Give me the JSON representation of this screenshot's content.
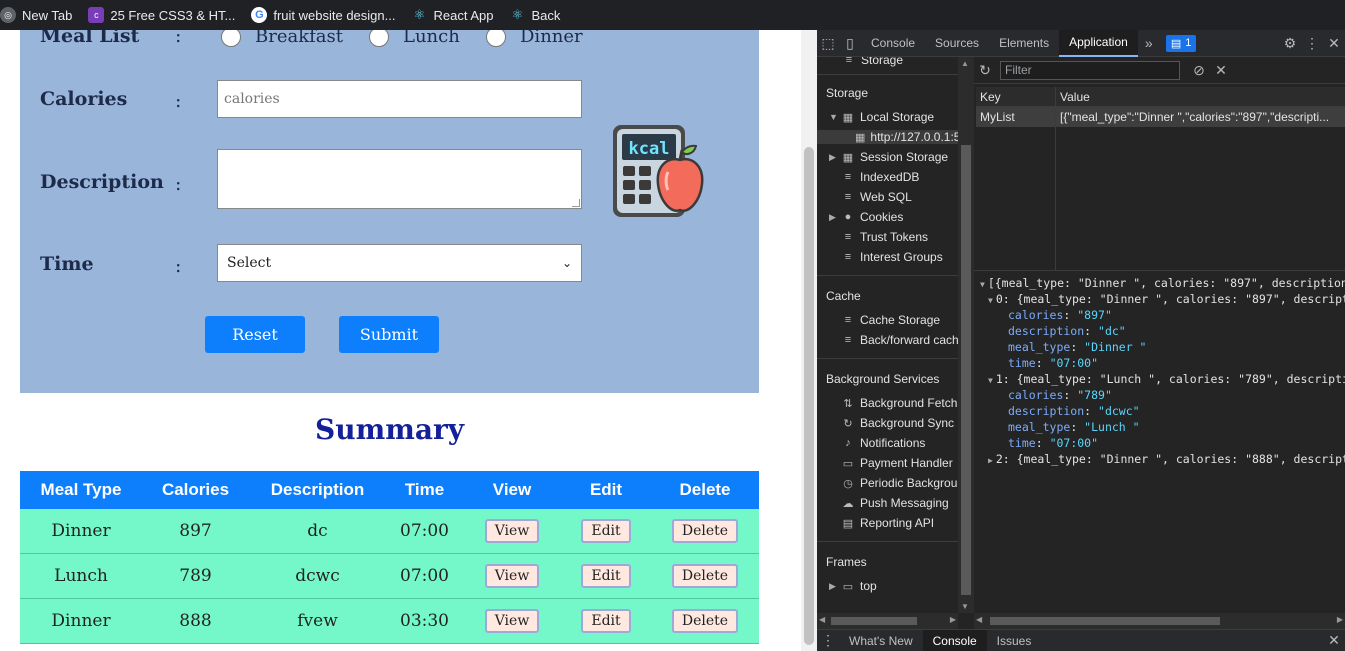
{
  "bookmarks": [
    {
      "label": "New Tab",
      "icon": "globe-icon"
    },
    {
      "label": "25 Free CSS3 & HT...",
      "icon": "colorlib-icon"
    },
    {
      "label": "fruit website design...",
      "icon": "google-icon"
    },
    {
      "label": "React App",
      "icon": "react-icon"
    },
    {
      "label": "Back",
      "icon": "react-icon"
    }
  ],
  "form": {
    "meal_label": "Meal List",
    "meal_options": [
      "Breakfast",
      "Lunch",
      "Dinner"
    ],
    "calories_label": "Calories",
    "calories_placeholder": "calories",
    "description_label": "Description",
    "time_label": "Time",
    "time_selected": "Select",
    "colon": ":",
    "reset_label": "Reset",
    "submit_label": "Submit",
    "image_text": "kcal"
  },
  "summary": {
    "title": "Summary",
    "headers": [
      "Meal Type",
      "Calories",
      "Description",
      "Time",
      "View",
      "Edit",
      "Delete"
    ],
    "rows": [
      {
        "meal_type": "Dinner",
        "calories": "897",
        "description": "dc",
        "time": "07:00",
        "view": "View",
        "edit": "Edit",
        "delete": "Delete"
      },
      {
        "meal_type": "Lunch",
        "calories": "789",
        "description": "dcwc",
        "time": "07:00",
        "view": "View",
        "edit": "Edit",
        "delete": "Delete"
      },
      {
        "meal_type": "Dinner",
        "calories": "888",
        "description": "fvew",
        "time": "03:30",
        "view": "View",
        "edit": "Edit",
        "delete": "Delete"
      }
    ]
  },
  "devtools": {
    "tabs": [
      "Console",
      "Sources",
      "Elements",
      "Application"
    ],
    "active_tab": "Application",
    "issue_count": "1",
    "sidebar": {
      "storage_header": "Storage",
      "local_storage": "Local Storage",
      "local_storage_origin": "http://127.0.0.1:5",
      "session_storage": "Session Storage",
      "indexeddb": "IndexedDB",
      "web_sql": "Web SQL",
      "cookies": "Cookies",
      "trust_tokens": "Trust Tokens",
      "interest_groups": "Interest Groups",
      "cache_header": "Cache",
      "cache_storage": "Cache Storage",
      "back_forward": "Back/forward cach",
      "bg_header": "Background Services",
      "bg_fetch": "Background Fetch",
      "bg_sync": "Background Sync",
      "notifications": "Notifications",
      "payment_handler": "Payment Handler",
      "periodic": "Periodic Backgroun",
      "push": "Push Messaging",
      "reporting": "Reporting API",
      "frames_header": "Frames",
      "top_frame": "top",
      "cut_item": "Storage"
    },
    "filter_placeholder": "Filter",
    "table": {
      "key_header": "Key",
      "value_header": "Value",
      "key": "MyList",
      "value": "[{\"meal_type\":\"Dinner \",\"calories\":\"897\",\"descripti..."
    },
    "json_lines": [
      {
        "indent": 0,
        "tri": "▼",
        "text": "[{meal_type: \"Dinner \", calories: \"897\", description:"
      },
      {
        "indent": 1,
        "tri": "▼",
        "text": "0: {meal_type: \"Dinner \", calories: \"897\", descripti"
      },
      {
        "indent": 2,
        "key": "calories",
        "val": "\"897\""
      },
      {
        "indent": 2,
        "key": "description",
        "val": "\"dc\""
      },
      {
        "indent": 2,
        "key": "meal_type",
        "val": "\"Dinner \""
      },
      {
        "indent": 2,
        "key": "time",
        "val": "\"07:00\""
      },
      {
        "indent": 1,
        "tri": "▼",
        "text": "1: {meal_type: \"Lunch \", calories: \"789\", descriptio"
      },
      {
        "indent": 2,
        "key": "calories",
        "val": "\"789\""
      },
      {
        "indent": 2,
        "key": "description",
        "val": "\"dcwc\""
      },
      {
        "indent": 2,
        "key": "meal_type",
        "val": "\"Lunch \""
      },
      {
        "indent": 2,
        "key": "time",
        "val": "\"07:00\""
      },
      {
        "indent": 1,
        "tri": "▶",
        "text": "2: {meal_type: \"Dinner \", calories: \"888\", descripti"
      }
    ],
    "drawer_tabs": [
      "What's New",
      "Console",
      "Issues"
    ],
    "drawer_active": "Console"
  },
  "colors": {
    "panel_bg": "#99b5d9",
    "primary_blue": "#0d7ffd",
    "row_green": "#74f8c9",
    "summary_title": "#14209a"
  }
}
